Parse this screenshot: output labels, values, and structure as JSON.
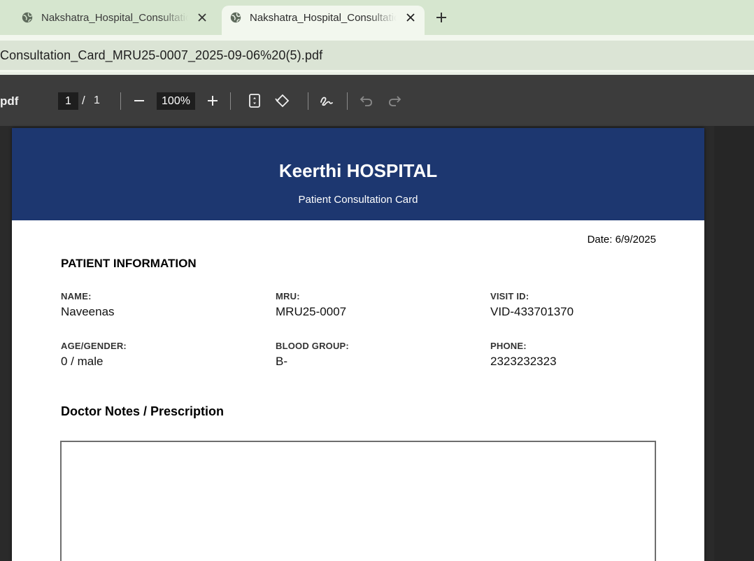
{
  "browser": {
    "tabs": [
      {
        "title": "Nakshatra_Hospital_Consultation_Card",
        "active": false
      },
      {
        "title": "Nakshatra_Hospital_Consultation_Card",
        "active": true
      }
    ],
    "address": "Consultation_Card_MRU25-0007_2025-09-06%20(5).pdf"
  },
  "pdf_toolbar": {
    "file_name": "pdf",
    "page_current": "1",
    "page_separator": "/",
    "page_total": "1",
    "zoom": "100%"
  },
  "document": {
    "hospital_name": "Keerthi HOSPITAL",
    "card_title": "Patient Consultation Card",
    "date": "Date: 6/9/2025",
    "section_title": "PATIENT INFORMATION",
    "fields": {
      "name": {
        "label": "NAME:",
        "value": "Naveenas"
      },
      "mru": {
        "label": "MRU:",
        "value": "MRU25-0007"
      },
      "visit_id": {
        "label": "VISIT ID:",
        "value": "VID-433701370"
      },
      "age_gender": {
        "label": "AGE/GENDER:",
        "value": "0 / male"
      },
      "blood_group": {
        "label": "BLOOD GROUP:",
        "value": "B-"
      },
      "phone": {
        "label": "PHONE:",
        "value": "2323232323"
      }
    },
    "notes_title": "Doctor Notes / Prescription"
  },
  "colors": {
    "banner": "#1d3770",
    "tabstrip": "#d6e6cf",
    "toolbar": "#3c3c3c"
  }
}
